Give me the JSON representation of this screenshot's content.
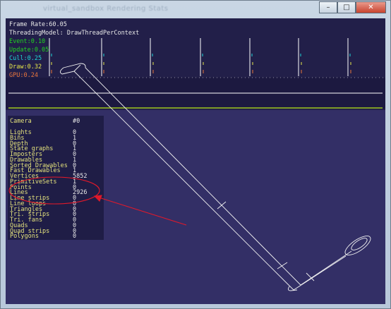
{
  "window": {
    "title": "virtual_sandbox Rendering Stats",
    "controls": {
      "minimize": "–",
      "maximize": "□",
      "close": "✕"
    }
  },
  "hud": {
    "frame_rate": "Frame Rate:60.05",
    "threading_model": "ThreadingModel: DrawThreadPerContext",
    "bars": [
      {
        "label": "Event:0.10",
        "color": "#21d421"
      },
      {
        "label": "Update:0.05",
        "color": "#21d421"
      },
      {
        "label": "Cull:0.25",
        "color": "#1fd6d6"
      },
      {
        "label": "Draw:0.32",
        "color": "#e8e84a"
      },
      {
        "label": "GPU:0.24",
        "color": "#e8743a"
      }
    ]
  },
  "scene_stats": {
    "header": {
      "label": "Camera",
      "value": "#0"
    },
    "rows": [
      {
        "label": "Lights",
        "value": "0"
      },
      {
        "label": "Bins",
        "value": "1"
      },
      {
        "label": "Depth",
        "value": "0"
      },
      {
        "label": "State graphs",
        "value": "1"
      },
      {
        "label": "Imposters",
        "value": "0"
      },
      {
        "label": "Drawables",
        "value": "1"
      },
      {
        "label": "Sorted Drawables",
        "value": "0"
      },
      {
        "label": "Fast Drawables",
        "value": "1"
      },
      {
        "label": "Vertices",
        "value": "5852"
      },
      {
        "label": "PrimitiveSets",
        "value": "1"
      },
      {
        "label": "Points",
        "value": "0"
      },
      {
        "label": "Lines",
        "value": "2926"
      },
      {
        "label": "Line strips",
        "value": "0"
      },
      {
        "label": "Line loops",
        "value": "0"
      },
      {
        "label": "Triangles",
        "value": "0"
      },
      {
        "label": "Tri. strips",
        "value": "0"
      },
      {
        "label": "Tri. fans",
        "value": "0"
      },
      {
        "label": "Quads",
        "value": "0"
      },
      {
        "label": "Quad strips",
        "value": "0"
      },
      {
        "label": "Polygons",
        "value": "0"
      }
    ]
  },
  "colors": {
    "background": "#332f66",
    "annotation": "#e0192a",
    "wireframe": "#f2f2f2"
  }
}
